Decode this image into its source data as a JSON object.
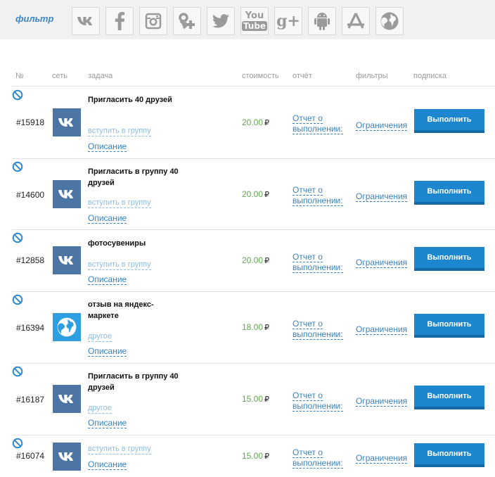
{
  "filter": {
    "label": "фильтр",
    "icons": [
      "vk-icon",
      "facebook-icon",
      "instagram-icon",
      "odnoklassniki-icon",
      "twitter-icon",
      "youtube-icon",
      "google-plus-icon",
      "android-icon",
      "appstore-icon",
      "globe-icon"
    ],
    "youtube_text_1": "You",
    "youtube_text_2": "Tube",
    "gplus_text": "g+"
  },
  "header": {
    "num": "№",
    "network": "сеть",
    "task": "задача",
    "price": "стоимость",
    "report": "отчёт",
    "filters": "фильтры",
    "subscribe": "подписка"
  },
  "currency": "₽",
  "tasks": [
    {
      "id": "#15918",
      "network": "vk",
      "title": "Пригласить 40 друзей",
      "action": "вступить в группу",
      "desc": "Описание",
      "price": "20.00",
      "report": "Отчет о выполнении:",
      "limits": "Ограничения",
      "button": "Выполнить"
    },
    {
      "id": "#14600",
      "network": "vk",
      "title": "Пригласить в группу 40 друзей",
      "action": "вступить в группу",
      "desc": "Описание",
      "price": "20.00",
      "report": "Отчет о выполнении:",
      "limits": "Ограничения",
      "button": "Выполнить"
    },
    {
      "id": "#12858",
      "network": "vk",
      "title": "фотосувениры",
      "action": "вступить в группу",
      "desc": "Описание",
      "price": "20.00",
      "report": "Отчет о выполнении:",
      "limits": "Ограничения",
      "button": "Выполнить"
    },
    {
      "id": "#16394",
      "network": "web",
      "title": "отзыв на яндекс-маркете",
      "action": "другое",
      "desc": "Описание",
      "price": "18.00",
      "report": "Отчет о выполнении:",
      "limits": "Ограничения",
      "button": "Выполнить"
    },
    {
      "id": "#16187",
      "network": "vk",
      "title": "Пригласить в группу 40 друзей",
      "action": "другое",
      "desc": "Описание",
      "price": "15.00",
      "report": "Отчет о выполнении:",
      "limits": "Ограничения",
      "button": "Выполнить"
    },
    {
      "id": "#16074",
      "network": "vk",
      "title": "",
      "action": "вступить в группу",
      "desc": "Описание",
      "price": "15.00",
      "report": "Отчет о выполнении:",
      "limits": "Ограничения",
      "button": "Выполнить"
    }
  ]
}
